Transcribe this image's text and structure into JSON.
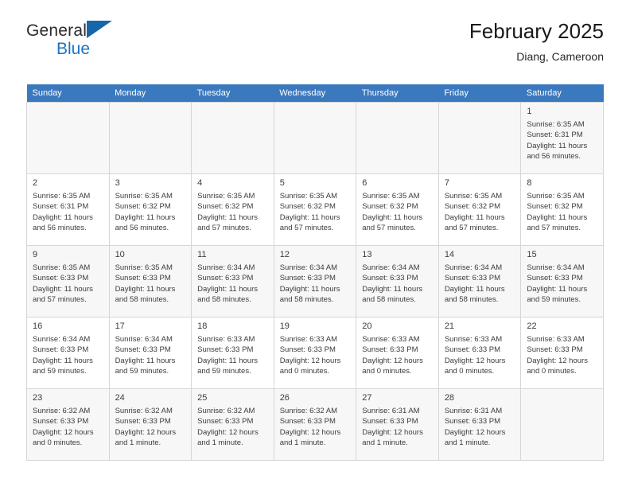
{
  "brand": {
    "name_part1": "General",
    "name_part2": "Blue",
    "logo_icon": "triangle-logo-icon"
  },
  "header": {
    "title": "February 2025",
    "subtitle": "Diang, Cameroon"
  },
  "colors": {
    "header_row_bg": "#3a79bd",
    "brand_blue": "#1b74c4",
    "shaded_row_bg": "#f7f7f7",
    "cell_border": "#d6d6d6"
  },
  "weekdays": [
    "Sunday",
    "Monday",
    "Tuesday",
    "Wednesday",
    "Thursday",
    "Friday",
    "Saturday"
  ],
  "weeks": [
    [
      {
        "day": "",
        "empty": true
      },
      {
        "day": "",
        "empty": true
      },
      {
        "day": "",
        "empty": true
      },
      {
        "day": "",
        "empty": true
      },
      {
        "day": "",
        "empty": true
      },
      {
        "day": "",
        "empty": true
      },
      {
        "day": "1",
        "sunrise": "Sunrise: 6:35 AM",
        "sunset": "Sunset: 6:31 PM",
        "daylight": "Daylight: 11 hours and 56 minutes."
      }
    ],
    [
      {
        "day": "2",
        "sunrise": "Sunrise: 6:35 AM",
        "sunset": "Sunset: 6:31 PM",
        "daylight": "Daylight: 11 hours and 56 minutes."
      },
      {
        "day": "3",
        "sunrise": "Sunrise: 6:35 AM",
        "sunset": "Sunset: 6:32 PM",
        "daylight": "Daylight: 11 hours and 56 minutes."
      },
      {
        "day": "4",
        "sunrise": "Sunrise: 6:35 AM",
        "sunset": "Sunset: 6:32 PM",
        "daylight": "Daylight: 11 hours and 57 minutes."
      },
      {
        "day": "5",
        "sunrise": "Sunrise: 6:35 AM",
        "sunset": "Sunset: 6:32 PM",
        "daylight": "Daylight: 11 hours and 57 minutes."
      },
      {
        "day": "6",
        "sunrise": "Sunrise: 6:35 AM",
        "sunset": "Sunset: 6:32 PM",
        "daylight": "Daylight: 11 hours and 57 minutes."
      },
      {
        "day": "7",
        "sunrise": "Sunrise: 6:35 AM",
        "sunset": "Sunset: 6:32 PM",
        "daylight": "Daylight: 11 hours and 57 minutes."
      },
      {
        "day": "8",
        "sunrise": "Sunrise: 6:35 AM",
        "sunset": "Sunset: 6:32 PM",
        "daylight": "Daylight: 11 hours and 57 minutes."
      }
    ],
    [
      {
        "day": "9",
        "sunrise": "Sunrise: 6:35 AM",
        "sunset": "Sunset: 6:33 PM",
        "daylight": "Daylight: 11 hours and 57 minutes."
      },
      {
        "day": "10",
        "sunrise": "Sunrise: 6:35 AM",
        "sunset": "Sunset: 6:33 PM",
        "daylight": "Daylight: 11 hours and 58 minutes."
      },
      {
        "day": "11",
        "sunrise": "Sunrise: 6:34 AM",
        "sunset": "Sunset: 6:33 PM",
        "daylight": "Daylight: 11 hours and 58 minutes."
      },
      {
        "day": "12",
        "sunrise": "Sunrise: 6:34 AM",
        "sunset": "Sunset: 6:33 PM",
        "daylight": "Daylight: 11 hours and 58 minutes."
      },
      {
        "day": "13",
        "sunrise": "Sunrise: 6:34 AM",
        "sunset": "Sunset: 6:33 PM",
        "daylight": "Daylight: 11 hours and 58 minutes."
      },
      {
        "day": "14",
        "sunrise": "Sunrise: 6:34 AM",
        "sunset": "Sunset: 6:33 PM",
        "daylight": "Daylight: 11 hours and 58 minutes."
      },
      {
        "day": "15",
        "sunrise": "Sunrise: 6:34 AM",
        "sunset": "Sunset: 6:33 PM",
        "daylight": "Daylight: 11 hours and 59 minutes."
      }
    ],
    [
      {
        "day": "16",
        "sunrise": "Sunrise: 6:34 AM",
        "sunset": "Sunset: 6:33 PM",
        "daylight": "Daylight: 11 hours and 59 minutes."
      },
      {
        "day": "17",
        "sunrise": "Sunrise: 6:34 AM",
        "sunset": "Sunset: 6:33 PM",
        "daylight": "Daylight: 11 hours and 59 minutes."
      },
      {
        "day": "18",
        "sunrise": "Sunrise: 6:33 AM",
        "sunset": "Sunset: 6:33 PM",
        "daylight": "Daylight: 11 hours and 59 minutes."
      },
      {
        "day": "19",
        "sunrise": "Sunrise: 6:33 AM",
        "sunset": "Sunset: 6:33 PM",
        "daylight": "Daylight: 12 hours and 0 minutes."
      },
      {
        "day": "20",
        "sunrise": "Sunrise: 6:33 AM",
        "sunset": "Sunset: 6:33 PM",
        "daylight": "Daylight: 12 hours and 0 minutes."
      },
      {
        "day": "21",
        "sunrise": "Sunrise: 6:33 AM",
        "sunset": "Sunset: 6:33 PM",
        "daylight": "Daylight: 12 hours and 0 minutes."
      },
      {
        "day": "22",
        "sunrise": "Sunrise: 6:33 AM",
        "sunset": "Sunset: 6:33 PM",
        "daylight": "Daylight: 12 hours and 0 minutes."
      }
    ],
    [
      {
        "day": "23",
        "sunrise": "Sunrise: 6:32 AM",
        "sunset": "Sunset: 6:33 PM",
        "daylight": "Daylight: 12 hours and 0 minutes."
      },
      {
        "day": "24",
        "sunrise": "Sunrise: 6:32 AM",
        "sunset": "Sunset: 6:33 PM",
        "daylight": "Daylight: 12 hours and 1 minute."
      },
      {
        "day": "25",
        "sunrise": "Sunrise: 6:32 AM",
        "sunset": "Sunset: 6:33 PM",
        "daylight": "Daylight: 12 hours and 1 minute."
      },
      {
        "day": "26",
        "sunrise": "Sunrise: 6:32 AM",
        "sunset": "Sunset: 6:33 PM",
        "daylight": "Daylight: 12 hours and 1 minute."
      },
      {
        "day": "27",
        "sunrise": "Sunrise: 6:31 AM",
        "sunset": "Sunset: 6:33 PM",
        "daylight": "Daylight: 12 hours and 1 minute."
      },
      {
        "day": "28",
        "sunrise": "Sunrise: 6:31 AM",
        "sunset": "Sunset: 6:33 PM",
        "daylight": "Daylight: 12 hours and 1 minute."
      },
      {
        "day": "",
        "empty": true
      }
    ]
  ]
}
